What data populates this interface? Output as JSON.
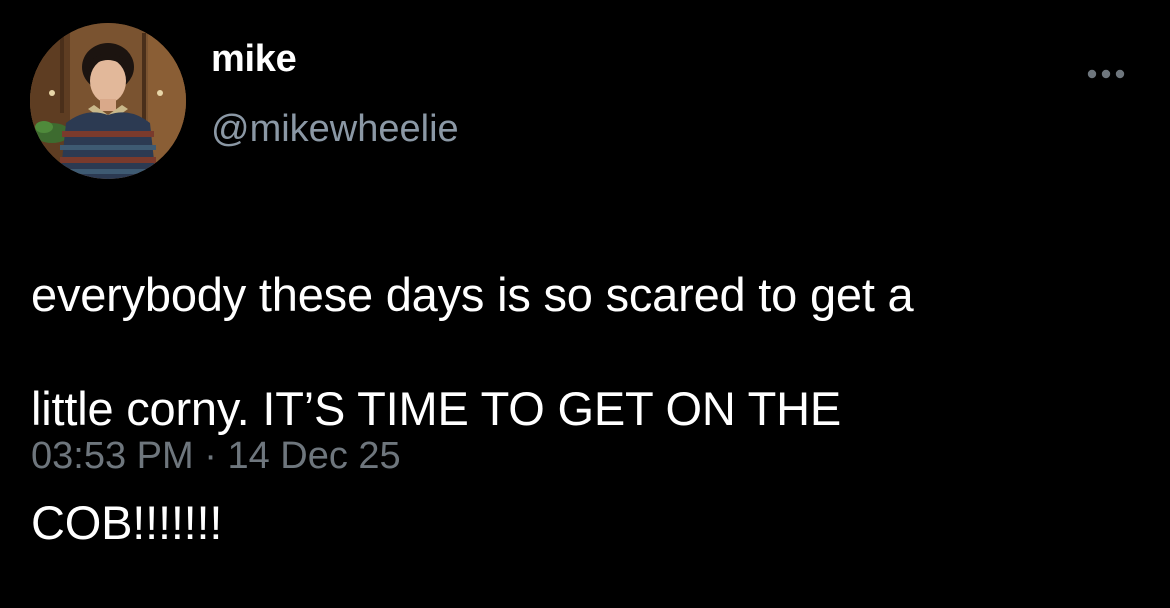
{
  "tweet": {
    "avatar_icon": "profile-photo",
    "display_name": "mike",
    "handle": "@mikewheelie",
    "more_icon": "more-horizontal-icon",
    "text_line1": "everybody these days is so scared to get a",
    "text_line2": "little corny. IT’S TIME TO GET ON THE",
    "text_line3": "COB!!!!!!!",
    "time": "03:53 PM",
    "separator": " · ",
    "date": "14 Dec 25"
  },
  "colors": {
    "background": "#000000",
    "name": "#ffffff",
    "handle": "#8b98a5",
    "body_text": "#ffffff",
    "meta": "#6e767d"
  }
}
